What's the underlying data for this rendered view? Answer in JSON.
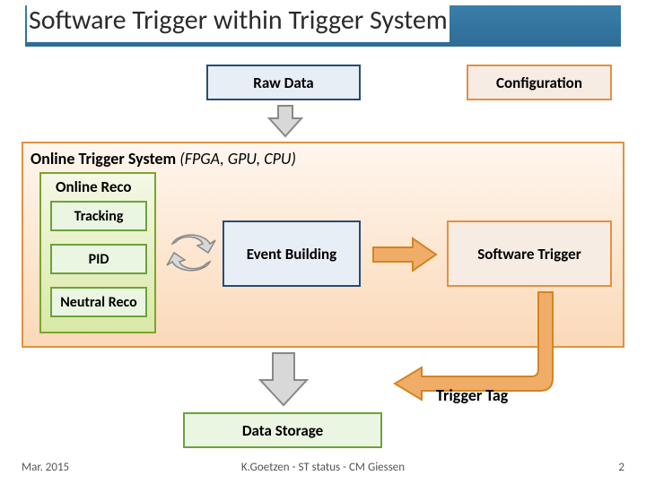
{
  "title": "Software Trigger within Trigger System",
  "boxes": {
    "raw_data": "Raw Data",
    "configuration": "Configuration",
    "system_label_bold": "Online Trigger System",
    "system_label_italic": "(FPGA, GPU, CPU)",
    "online_reco": "Online Reco",
    "tracking": "Tracking",
    "pid": "PID",
    "neutral": "Neutral Reco",
    "event_building": "Event Building",
    "software_trigger": "Software Trigger",
    "trigger_tag": "Trigger Tag",
    "data_storage": "Data Storage"
  },
  "footer": {
    "date": "Mar. 2015",
    "center": "K.Goetzen - ST status - CM Giessen",
    "page": "2"
  },
  "colors": {
    "blue_border": "#274b78",
    "orange_border": "#e29142",
    "green_border": "#6aa33a",
    "arrow_orange_fill": "#f0ad68",
    "arrow_orange_stroke": "#d48424",
    "arrow_gray_fill": "#d8d8d8",
    "arrow_gray_stroke": "#888"
  }
}
